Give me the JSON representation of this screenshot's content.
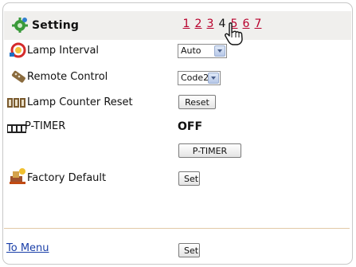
{
  "header": {
    "title": "Setting",
    "pages": [
      "1",
      "2",
      "3",
      "4",
      "5",
      "6",
      "7"
    ],
    "current_page": "4"
  },
  "rows": {
    "lamp_interval": {
      "label": "Lamp Interval",
      "value": "Auto"
    },
    "remote_control": {
      "label": "Remote Control",
      "value": "Code2"
    },
    "lamp_counter_reset": {
      "label": "Lamp Counter Reset",
      "button": "Reset"
    },
    "p_timer": {
      "label": "P-TIMER",
      "status": "OFF",
      "button": "P-TIMER"
    },
    "factory_default": {
      "label": "Factory Default",
      "button": "Set"
    }
  },
  "footer": {
    "menu_link": "To Menu",
    "set_button": "Set"
  },
  "colors": {
    "link": "#b8002c",
    "menu_link": "#1a3fa8",
    "header_bg": "#f0efed"
  }
}
